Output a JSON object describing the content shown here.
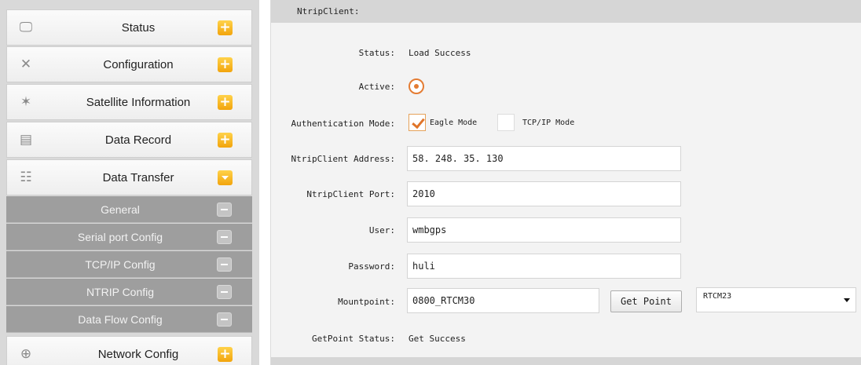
{
  "sidebar": {
    "items": [
      {
        "label": "Status",
        "icon": "monitor-icon",
        "toggle": "+"
      },
      {
        "label": "Configuration",
        "icon": "tools-icon",
        "toggle": "+"
      },
      {
        "label": "Satellite Information",
        "icon": "satellite-icon",
        "toggle": "+"
      },
      {
        "label": "Data Record",
        "icon": "calendar-icon",
        "toggle": "+"
      },
      {
        "label": "Data Transfer",
        "icon": "network-transfer-icon",
        "toggle": "expanded"
      }
    ],
    "subitems": [
      {
        "label": "General"
      },
      {
        "label": "Serial port Config"
      },
      {
        "label": "TCP/IP Config"
      },
      {
        "label": "NTRIP Config"
      },
      {
        "label": "Data Flow Config"
      }
    ],
    "last_item": {
      "label": "Network Config",
      "icon": "globe-icon",
      "toggle": "+"
    }
  },
  "panel": {
    "title": "NtripClient:",
    "status_label": "Status:",
    "status_value": "Load Success",
    "active_label": "Active:",
    "auth_label": "Authentication Mode:",
    "auth_options": [
      "Eagle Mode",
      "TCP/IP Mode"
    ],
    "auth_selected": "Eagle Mode",
    "address_label": "NtripClient Address:",
    "address_value": "58. 248. 35. 130",
    "port_label": "NtripClient Port:",
    "port_value": "2010",
    "user_label": "User:",
    "user_value": "wmbgps",
    "password_label": "Password:",
    "password_value": "huli",
    "mountpoint_label": "Mountpoint:",
    "mountpoint_value": "0800_RTCM30",
    "get_point_button": "Get Point",
    "format_select": "RTCM23",
    "getpoint_status_label": "GetPoint Status:",
    "getpoint_status_value": "Get Success"
  },
  "colors": {
    "accent_orange": "#e47c33",
    "plus_button": "#f2a40c",
    "submenu_bg": "#9e9e9e"
  }
}
